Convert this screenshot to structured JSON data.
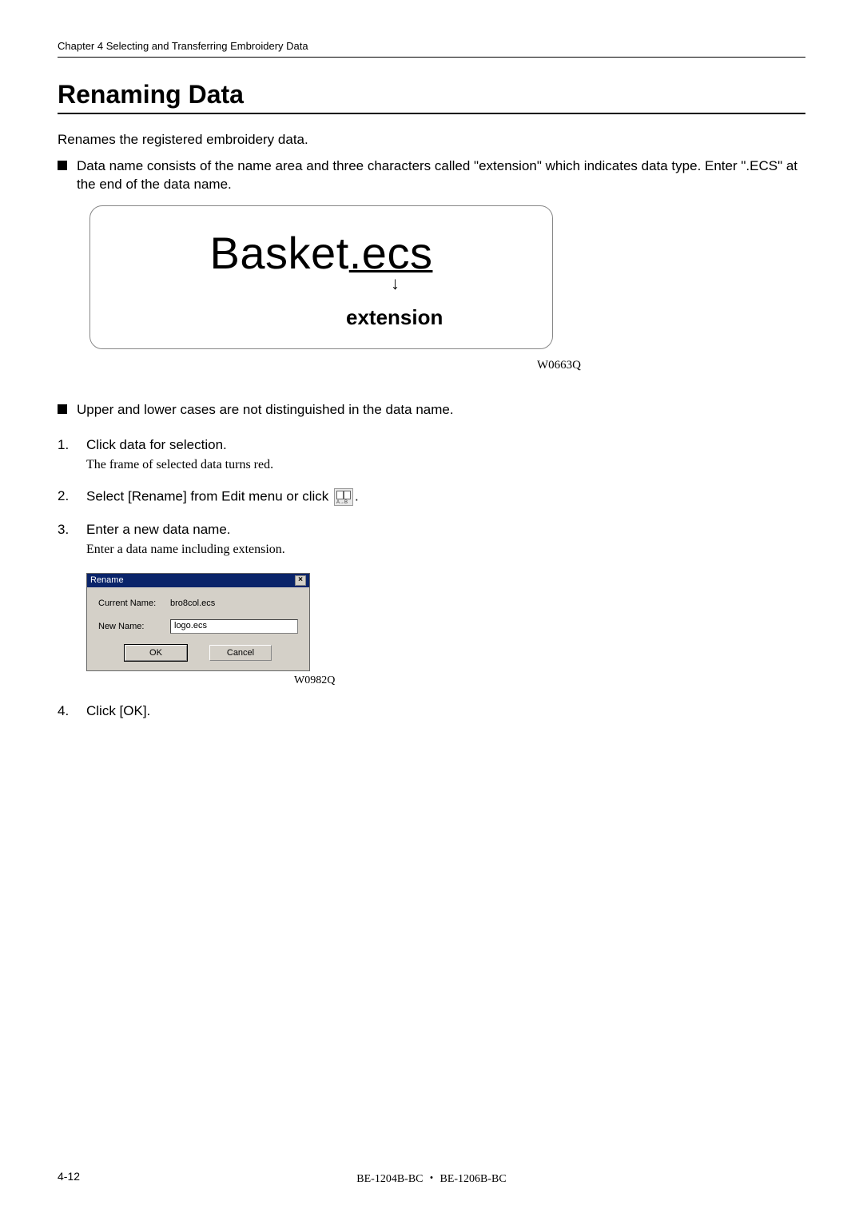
{
  "header": {
    "chapter": "Chapter 4    Selecting and Transferring Embroidery Data"
  },
  "title": "Renaming Data",
  "intro": "Renames the registered embroidery data.",
  "bullet1": "Data name consists of the name area and three characters called \"extension\" which indicates data type. Enter \".ECS\" at the end of the data name.",
  "diagram": {
    "basename": "Basket",
    "ext": ".ecs",
    "arrow": "↓",
    "label": "extension",
    "code": "W0663Q"
  },
  "bullet2": "Upper and lower cases are not distinguished in the data name.",
  "steps": {
    "s1_num": "1.",
    "s1_text": "Click data for selection.",
    "s1_sub": "The frame of selected data turns red.",
    "s2_num": "2.",
    "s2_text_pre": "Select [Rename] from Edit menu or click ",
    "s2_icon_ab": "A→B",
    "s2_text_post": ".",
    "s3_num": "3.",
    "s3_text": "Enter a new data name.",
    "s3_sub": "Enter a data name including extension.",
    "s4_num": "4.",
    "s4_text": "Click [OK]."
  },
  "dialog": {
    "title": "Rename",
    "close": "×",
    "current_label": "Current Name:",
    "current_value": "bro8col.ecs",
    "new_label": "New Name:",
    "new_value": "logo.ecs",
    "ok": "OK",
    "cancel": "Cancel",
    "code": "W0982Q"
  },
  "footer": {
    "page": "4-12",
    "product": "BE-1204B-BC ・ BE-1206B-BC"
  }
}
